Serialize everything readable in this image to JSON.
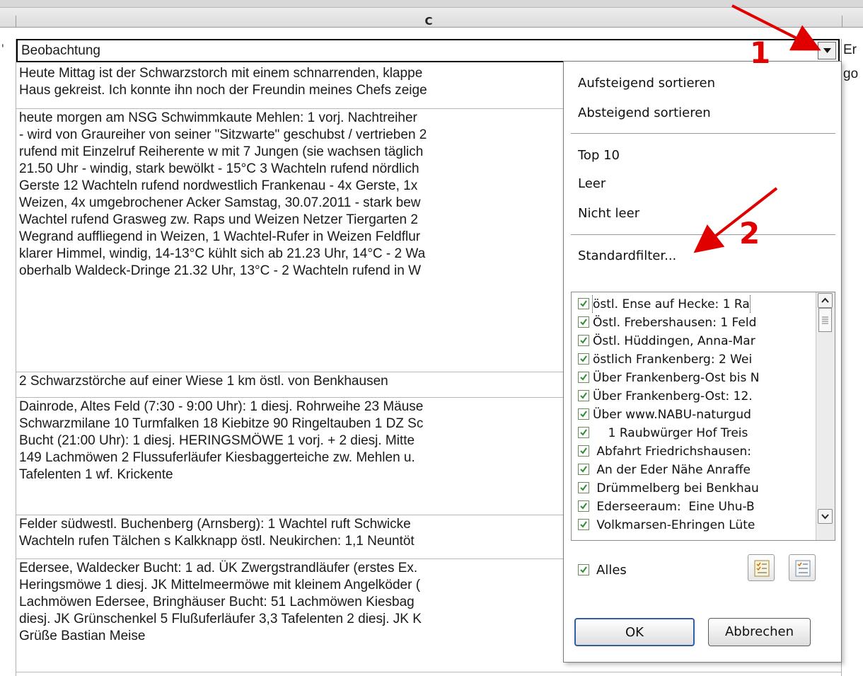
{
  "column_header": "C",
  "header_cell": {
    "text": "Beobachtung",
    "right_fragment": "Er",
    "left_fragment": "'"
  },
  "row1_right_fragment": "go",
  "rows": [
    {
      "lines": [
        "Heute Mittag ist der Schwarzstorch mit einem schnarrenden, klappe",
        "Haus gekreist. Ich konnte ihn noch der Freundin meines Chefs zeige"
      ]
    },
    {
      "lines": [
        "heute morgen am NSG Schwimmkaute Mehlen:  1 vorj. Nachtreiher",
        "- wird von Graureiher von seiner \"Sitzwarte\" geschubst / vertrieben 2",
        "rufend mit Einzelruf Reiherente w mit 7 Jungen (sie wachsen täglich",
        "21.50 Uhr - windig, stark bewölkt - 15°C 3 Wachteln rufend nördlich",
        "Gerste 12 Wachteln rufend nordwestlich Frankenau - 4x Gerste, 1x",
        "Weizen, 4x umgebrochener Acker  Samstag, 30.07.2011 - stark bew",
        "Wachtel rufend  Grasweg zw. Raps und Weizen  Netzer Tiergarten 2",
        "Wegrand auffliegend in Weizen, 1 Wachtel-Rufer in Weizen  Feldflur",
        "klarer Himmel, windig, 14-13°C kühlt sich ab 21.23 Uhr, 14°C - 2 Wa",
        "oberhalb Waldeck-Dringe 21.32 Uhr, 13°C -  2 Wachteln rufend in W"
      ]
    },
    {
      "lines": [
        "2 Schwarzstörche auf einer Wiese 1 km östl. von Benkhausen"
      ]
    },
    {
      "lines": [
        "Dainrode, Altes Feld (7:30 - 9:00 Uhr): 1 diesj. Rohrweihe 23 Mäuse",
        "Schwarzmilane 10 Turmfalken 18 Kiebitze 90 Ringeltauben 1 DZ Sc",
        "Bucht (21:00 Uhr): 1 diesj. HERINGSMÖWE  1 vorj. + 2 diesj. Mitte",
        "149 Lachmöwen 2 Flussuferläufer  Kiesbaggerteiche zw. Mehlen u.",
        "Tafelenten 1 wf. Krickente"
      ]
    },
    {
      "lines": [
        "Felder südwestl. Buchenberg (Arnsberg): 1  Wachtel ruft  Schwicke",
        "Wachteln rufen  Tälchen s Kalkknapp östl. Neukirchen: 1,1 Neuntöt"
      ]
    },
    {
      "lines": [
        "Edersee, Waldecker Bucht: 1 ad. ÜK Zwergstrandläufer (erstes Ex.",
        "Heringsmöwe 1 diesj. JK Mittelmeermöwe mit kleinem Angelköder (",
        "Lachmöwen  Edersee, Bringhäuser Bucht: 51 Lachmöwen  Kiesbag",
        "diesj. JK Grünschenkel 5 Flußuferläufer 3,3 Tafelenten 2 diesj. JK K",
        "Grüße Bastian Meise"
      ]
    }
  ],
  "dropdown": {
    "menu": [
      "Aufsteigend sortieren",
      "Absteigend sortieren",
      "Top 10",
      "Leer",
      "Nicht leer",
      "Standardfilter..."
    ],
    "list": [
      "östl. Ense auf Hecke: 1 Ra",
      "Östl. Frebershausen: 1 Feld",
      "Östl. Hüddingen, Anna-Mar",
      "östlich Frankenberg: 2 Wei",
      "Über Frankenberg-Ost bis N",
      "Über Frankenberg-Ost: 12.",
      "Über www.NABU-naturgud",
      "    1 Raubwürger Hof Treis",
      " Abfahrt Friedrichshausen:",
      " An der Eder Nähe Anraffe",
      " Drümmelberg bei Benkhau",
      " Ederseeraum:  Eine Uhu-B",
      " Volkmarsen-Ehringen Lüte"
    ],
    "all_label": "Alles",
    "ok_label": "OK",
    "cancel_label": "Abbrechen"
  },
  "annotations": {
    "one": "1",
    "two": "2"
  },
  "colors": {
    "annotation": "#e00000",
    "check": "#2e8b2e"
  }
}
